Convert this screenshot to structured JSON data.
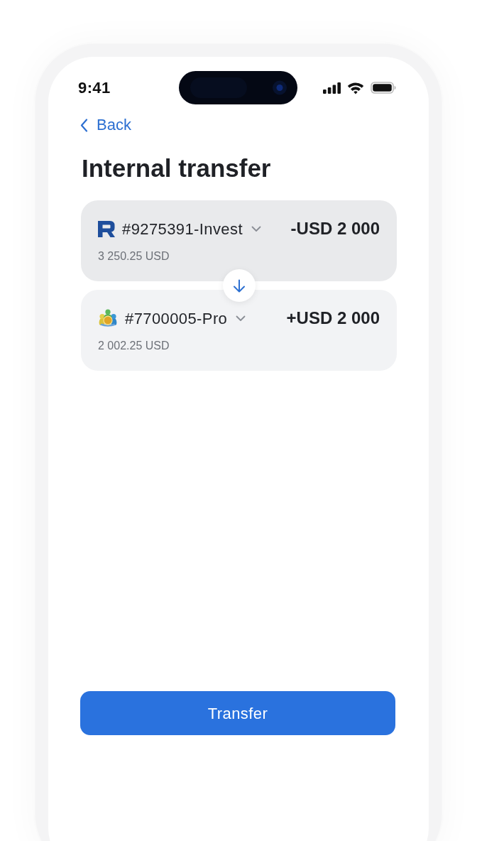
{
  "status_bar": {
    "time": "9:41"
  },
  "nav": {
    "back": "Back"
  },
  "title": "Internal transfer",
  "accounts": [
    {
      "kind": "monogram",
      "number": "#9275391-Invest",
      "amount": "-USD 2 000",
      "balance": "3 250.25 USD",
      "color": "#e9eaec"
    },
    {
      "kind": "emblem",
      "number": "#7700005-Pro",
      "amount": "+USD 2 000",
      "balance": "2 002.25 USD",
      "color": "#f2f3f5"
    }
  ],
  "button": {
    "label": "Transfer"
  }
}
